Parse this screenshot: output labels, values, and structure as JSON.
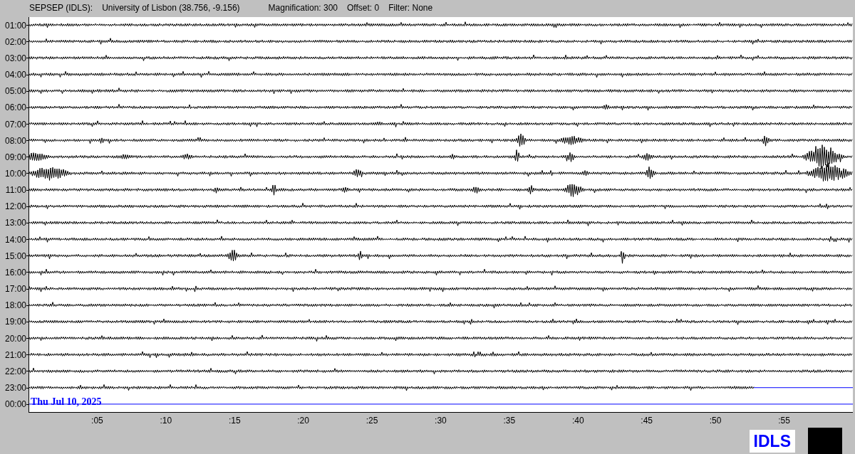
{
  "header": {
    "station": "SEPSEP (IDLS):",
    "location": "University of Lisbon (38.756, -9.156)",
    "magnification": "Magnification: 300",
    "offset": "Offset: 0",
    "filter": "Filter: None"
  },
  "rows": [
    {
      "label": "01:00",
      "kind": "recorded"
    },
    {
      "label": "02:00",
      "kind": "recorded"
    },
    {
      "label": "03:00",
      "kind": "recorded"
    },
    {
      "label": "04:00",
      "kind": "recorded"
    },
    {
      "label": "05:00",
      "kind": "recorded"
    },
    {
      "label": "06:00",
      "kind": "recorded"
    },
    {
      "label": "07:00",
      "kind": "recorded"
    },
    {
      "label": "08:00",
      "kind": "recorded"
    },
    {
      "label": "09:00",
      "kind": "recorded"
    },
    {
      "label": "10:00",
      "kind": "recorded"
    },
    {
      "label": "11:00",
      "kind": "recorded"
    },
    {
      "label": "12:00",
      "kind": "recorded"
    },
    {
      "label": "13:00",
      "kind": "recorded"
    },
    {
      "label": "14:00",
      "kind": "recorded"
    },
    {
      "label": "15:00",
      "kind": "recorded"
    },
    {
      "label": "16:00",
      "kind": "recorded"
    },
    {
      "label": "17:00",
      "kind": "recorded"
    },
    {
      "label": "18:00",
      "kind": "recorded"
    },
    {
      "label": "19:00",
      "kind": "recorded"
    },
    {
      "label": "20:00",
      "kind": "recorded"
    },
    {
      "label": "21:00",
      "kind": "recorded"
    },
    {
      "label": "22:00",
      "kind": "recorded"
    },
    {
      "label": "23:00",
      "kind": "partial"
    },
    {
      "label": "00:00",
      "kind": "pending"
    }
  ],
  "date_label": "Thu Jul 10, 2025",
  "x_ticks": [
    ":05",
    ":10",
    ":15",
    ":20",
    ":25",
    ":30",
    ":35",
    ":40",
    ":45",
    ":50",
    ":55"
  ],
  "logo": "IDLS"
}
